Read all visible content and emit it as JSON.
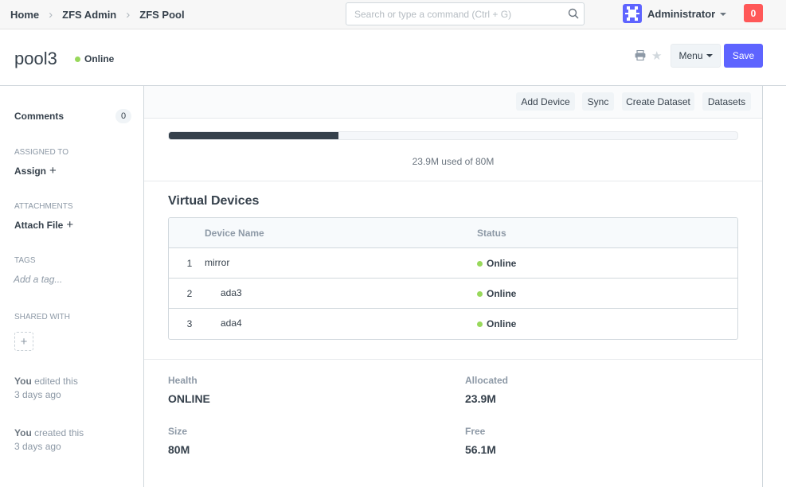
{
  "navbar": {
    "breadcrumbs": [
      "Home",
      "ZFS Admin",
      "ZFS Pool"
    ],
    "search_placeholder": "Search or type a command (Ctrl + G)",
    "user_name": "Administrator",
    "notification_count": "0",
    "colors": {
      "avatar": "#5e64ff",
      "notification": "#ff5858"
    }
  },
  "page": {
    "title": "pool3",
    "status": "Online",
    "status_color": "#98d85b",
    "menu_label": "Menu",
    "save_label": "Save",
    "accent": "#5e64ff"
  },
  "sidebar": {
    "comments_label": "Comments",
    "comments_count": "0",
    "assigned_to_label": "ASSIGNED TO",
    "assign_label": "Assign",
    "attachments_label": "ATTACHMENTS",
    "attach_file_label": "Attach File",
    "tags_label": "TAGS",
    "add_tag_placeholder": "Add a tag...",
    "shared_with_label": "SHARED WITH",
    "activity": [
      {
        "who": "You",
        "action": "edited this",
        "when": "3 days ago"
      },
      {
        "who": "You",
        "action": "created this",
        "when": "3 days ago"
      }
    ]
  },
  "toolbar": {
    "buttons": [
      "Add Device",
      "Sync",
      "Create Dataset",
      "Datasets"
    ]
  },
  "usage": {
    "text": "23.9M used of 80M",
    "fraction": 0.2988
  },
  "virtual_devices": {
    "title": "Virtual Devices",
    "columns": [
      "Device Name",
      "Status"
    ],
    "rows": [
      {
        "index": "1",
        "name": "mirror",
        "status": "Online",
        "indent": 0
      },
      {
        "index": "2",
        "name": "ada3",
        "status": "Online",
        "indent": 1
      },
      {
        "index": "3",
        "name": "ada4",
        "status": "Online",
        "indent": 1
      }
    ]
  },
  "properties": {
    "health_label": "Health",
    "health": "ONLINE",
    "allocated_label": "Allocated",
    "allocated": "23.9M",
    "size_label": "Size",
    "size": "80M",
    "free_label": "Free",
    "free": "56.1M"
  }
}
